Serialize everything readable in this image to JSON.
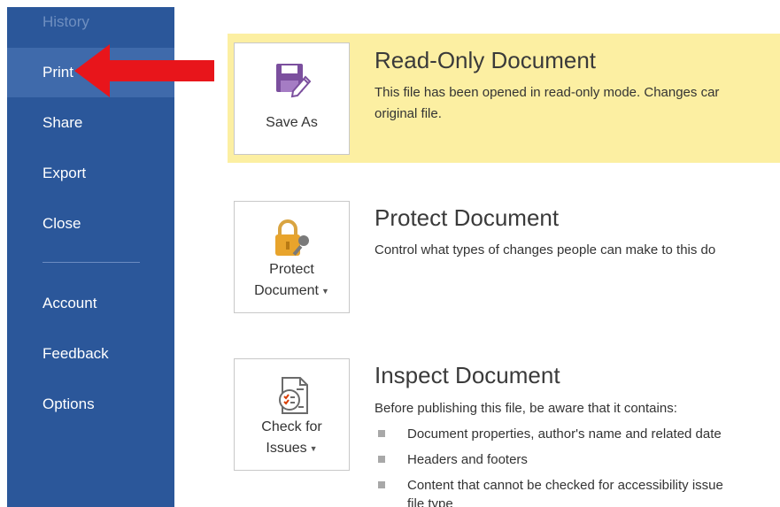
{
  "sidebar": {
    "items": [
      {
        "label": "History"
      },
      {
        "label": "Print"
      },
      {
        "label": "Share"
      },
      {
        "label": "Export"
      },
      {
        "label": "Close"
      },
      {
        "label": "Account"
      },
      {
        "label": "Feedback"
      },
      {
        "label": "Options"
      }
    ]
  },
  "read_only": {
    "title": "Read-Only Document",
    "desc_line1": "This file has been opened in read-only mode. Changes car",
    "desc_line2": "original file.",
    "button_label": "Save As",
    "icon": "save-as-icon"
  },
  "protect": {
    "title": "Protect Document",
    "desc": "Control what types of changes people can make to this do",
    "button_line1": "Protect",
    "button_line2": "Document",
    "icon": "lock-key-icon"
  },
  "inspect": {
    "title": "Inspect Document",
    "desc": "Before publishing this file, be aware that it contains:",
    "bullets": [
      "Document properties, author's name and related date",
      "Headers and footers",
      "Content that cannot be checked for accessibility issue"
    ],
    "overflow_text": "file type",
    "button_line1": "Check for",
    "button_line2": "Issues",
    "icon": "checklist-icon"
  },
  "colors": {
    "sidebar": "#2b579a",
    "banner": "#fcefa2",
    "arrow": "#e8151b"
  }
}
